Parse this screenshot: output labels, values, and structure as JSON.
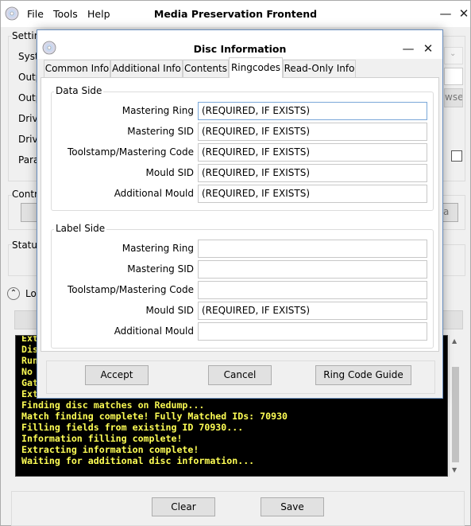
{
  "main": {
    "title": "Media Preservation Frontend",
    "menu": [
      "File",
      "Tools",
      "Help"
    ],
    "settings_label": "Settin",
    "settings_rows": [
      "Syst",
      "Outp",
      "Outp",
      "Driv",
      "Driv",
      "Para"
    ],
    "browse_fragment": "wse",
    "controls_label": "Contr",
    "controls_button_fragment": "a",
    "status_label": "Status",
    "log_toggle_label": "Lo",
    "log_lines": [
      "Ext",
      "Dis",
      "Run",
      "No ",
      "Gat",
      "Ext",
      "Finding disc matches on Redump...",
      "Match finding complete! Fully Matched IDs: 70930",
      "Filling fields from existing ID 70930...",
      "Information filling complete!",
      "Extracting information complete!",
      "Waiting for additional disc information..."
    ],
    "clear_label": "Clear",
    "save_label": "Save",
    "log_text_color": "#ffff55"
  },
  "dialog": {
    "title": "Disc Information",
    "tabs": [
      "Common Info",
      "Additional Info",
      "Contents",
      "Ringcodes",
      "Read-Only Info"
    ],
    "active_tab": "Ringcodes",
    "data_side": {
      "title": "Data Side",
      "fields": [
        {
          "label": "Mastering Ring",
          "value": "(REQUIRED, IF EXISTS)"
        },
        {
          "label": "Mastering SID",
          "value": "(REQUIRED, IF EXISTS)"
        },
        {
          "label": "Toolstamp/Mastering Code",
          "value": "(REQUIRED, IF EXISTS)"
        },
        {
          "label": "Mould SID",
          "value": "(REQUIRED, IF EXISTS)"
        },
        {
          "label": "Additional Mould",
          "value": "(REQUIRED, IF EXISTS)"
        }
      ]
    },
    "label_side": {
      "title": "Label Side",
      "fields": [
        {
          "label": "Mastering Ring",
          "value": ""
        },
        {
          "label": "Mastering SID",
          "value": ""
        },
        {
          "label": "Toolstamp/Mastering Code",
          "value": ""
        },
        {
          "label": "Mould SID",
          "value": "(REQUIRED, IF EXISTS)"
        },
        {
          "label": "Additional Mould",
          "value": ""
        }
      ]
    },
    "accept_label": "Accept",
    "cancel_label": "Cancel",
    "guide_label": "Ring Code Guide"
  }
}
